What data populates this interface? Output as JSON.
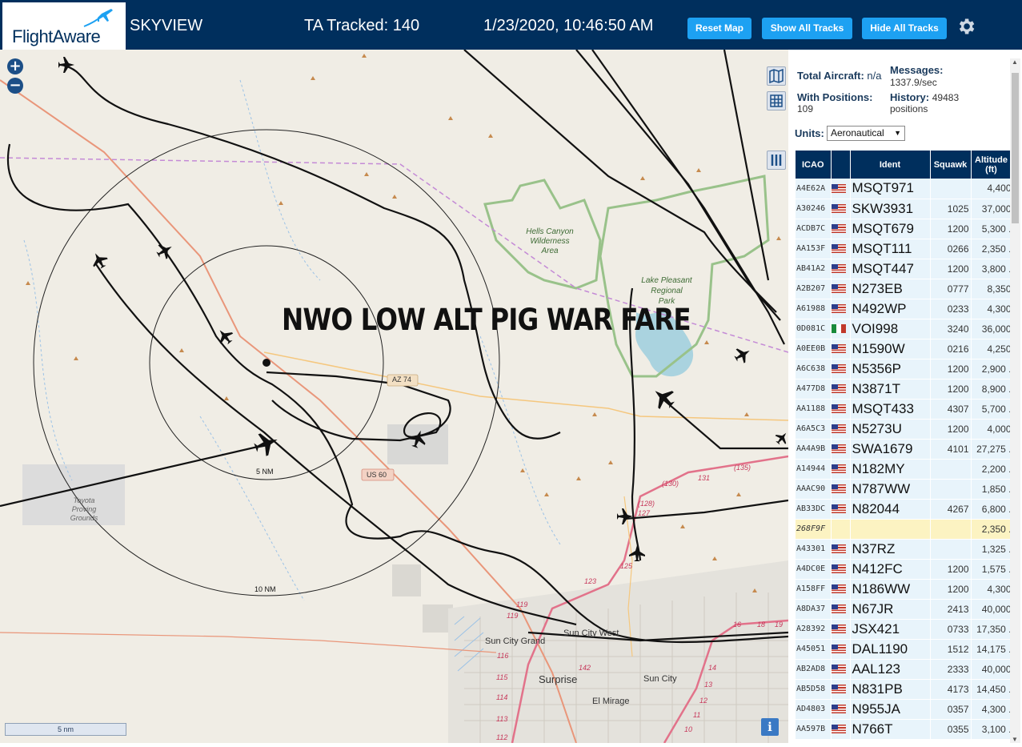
{
  "header": {
    "logo": "FlightAware",
    "app_title": "SKYVIEW",
    "tracked": "TA Tracked: 140",
    "datetime": "1/23/2020, 10:46:50 AM",
    "buttons": {
      "reset": "Reset Map",
      "show": "Show All Tracks",
      "hide": "Hide All Tracks"
    },
    "settings_icon": "gear-icon",
    "bg_color": "#002f5d",
    "button_color": "#1da1f2"
  },
  "map": {
    "overlay_title": "NWO LOW ALT PIG WAR FARE",
    "labels": {
      "hells_canyon": [
        "Hells Canyon",
        "Wilderness",
        "Area"
      ],
      "lake_pleasant": [
        "Lake Pleasant",
        "Regional",
        "Park"
      ],
      "toyota": [
        "Toyota",
        "Proving",
        "Grounds"
      ],
      "sun_city_grand": "Sun City Grand",
      "sun_city_west": "Sun City West",
      "surprise": "Surprise",
      "sun_city": "Sun City",
      "el_mirage": "El Mirage",
      "az74": "AZ 74",
      "us60": "US 60",
      "ring_5": "5 NM",
      "ring_10": "10 NM",
      "road_numbers": [
        "(135)",
        "(130)",
        "131",
        "(128)",
        "127",
        "125",
        "123",
        "119",
        "119",
        "116",
        "115",
        "114",
        "113",
        "112",
        "142",
        "16",
        "18",
        "19",
        "14",
        "13",
        "12",
        "11",
        "10"
      ]
    },
    "scale": "5 nm",
    "zoom_in": "+",
    "zoom_out": "−",
    "info": "i"
  },
  "sidebar": {
    "total_aircraft_label": "Total Aircraft:",
    "total_aircraft_value": "n/a",
    "with_positions_label": "With Positions:",
    "with_positions_value": "109",
    "messages_label": "Messages:",
    "messages_value": "1337.9/sec",
    "history_label": "History:",
    "history_value": "49483",
    "history_unit": "positions",
    "units_label": "Units:",
    "units_value": "Aeronautical",
    "columns": [
      "ICAO",
      "",
      "Ident",
      "Squawk",
      "Altitude (ft)"
    ],
    "rows": [
      {
        "icao": "A4E62A",
        "flag": "us",
        "ident": "MSQT971",
        "squawk": "",
        "alt": "4,400"
      },
      {
        "icao": "A30246",
        "flag": "us",
        "ident": "SKW3931",
        "squawk": "1025",
        "alt": "37,000"
      },
      {
        "icao": "ACDB7C",
        "flag": "us",
        "ident": "MSQT679",
        "squawk": "1200",
        "alt": "5,300 ."
      },
      {
        "icao": "AA153F",
        "flag": "us",
        "ident": "MSQT111",
        "squawk": "0266",
        "alt": "2,350 ."
      },
      {
        "icao": "AB41A2",
        "flag": "us",
        "ident": "MSQT447",
        "squawk": "1200",
        "alt": "3,800 ."
      },
      {
        "icao": "A2B207",
        "flag": "us",
        "ident": "N273EB",
        "squawk": "0777",
        "alt": "8,350"
      },
      {
        "icao": "A61988",
        "flag": "us",
        "ident": "N492WP",
        "squawk": "0233",
        "alt": "4,300"
      },
      {
        "icao": "0D081C",
        "flag": "mx",
        "ident": "VOI998",
        "squawk": "3240",
        "alt": "36,000"
      },
      {
        "icao": "A0EE0B",
        "flag": "us",
        "ident": "N1590W",
        "squawk": "0216",
        "alt": "4,250"
      },
      {
        "icao": "A6C638",
        "flag": "us",
        "ident": "N5356P",
        "squawk": "1200",
        "alt": "2,900 ."
      },
      {
        "icao": "A477D8",
        "flag": "us",
        "ident": "N3871T",
        "squawk": "1200",
        "alt": "8,900 ."
      },
      {
        "icao": "AA1188",
        "flag": "us",
        "ident": "MSQT433",
        "squawk": "4307",
        "alt": "5,700 ."
      },
      {
        "icao": "A6A5C3",
        "flag": "us",
        "ident": "N5273U",
        "squawk": "1200",
        "alt": "4,000"
      },
      {
        "icao": "AA4A9B",
        "flag": "us",
        "ident": "SWA1679",
        "squawk": "4101",
        "alt": "27,275 ."
      },
      {
        "icao": "A14944",
        "flag": "us",
        "ident": "N182MY",
        "squawk": "",
        "alt": "2,200 ."
      },
      {
        "icao": "AAAC90",
        "flag": "us",
        "ident": "N787WW",
        "squawk": "",
        "alt": "1,850 ."
      },
      {
        "icao": "AB33DC",
        "flag": "us",
        "ident": "N82044",
        "squawk": "4267",
        "alt": "6,800 ."
      },
      {
        "icao": "268F9F",
        "flag": "",
        "ident": "",
        "squawk": "",
        "alt": "2,350 .",
        "highlight": true
      },
      {
        "icao": "A43301",
        "flag": "us",
        "ident": "N37RZ",
        "squawk": "",
        "alt": "1,325 ."
      },
      {
        "icao": "A4DC0E",
        "flag": "us",
        "ident": "N412FC",
        "squawk": "1200",
        "alt": "1,575 ."
      },
      {
        "icao": "A158FF",
        "flag": "us",
        "ident": "N186WW",
        "squawk": "1200",
        "alt": "4,300"
      },
      {
        "icao": "A8DA37",
        "flag": "us",
        "ident": "N67JR",
        "squawk": "2413",
        "alt": "40,000"
      },
      {
        "icao": "A28392",
        "flag": "us",
        "ident": "JSX421",
        "squawk": "0733",
        "alt": "17,350 ."
      },
      {
        "icao": "A45051",
        "flag": "us",
        "ident": "DAL1190",
        "squawk": "1512",
        "alt": "14,175 ."
      },
      {
        "icao": "AB2AD8",
        "flag": "us",
        "ident": "AAL123",
        "squawk": "2333",
        "alt": "40,000"
      },
      {
        "icao": "AB5D58",
        "flag": "us",
        "ident": "N831PB",
        "squawk": "4173",
        "alt": "14,450 ."
      },
      {
        "icao": "AD4803",
        "flag": "us",
        "ident": "N955JA",
        "squawk": "0357",
        "alt": "4,300 ."
      },
      {
        "icao": "AA597B",
        "flag": "us",
        "ident": "N766T",
        "squawk": "0355",
        "alt": "3,100 ."
      }
    ]
  }
}
